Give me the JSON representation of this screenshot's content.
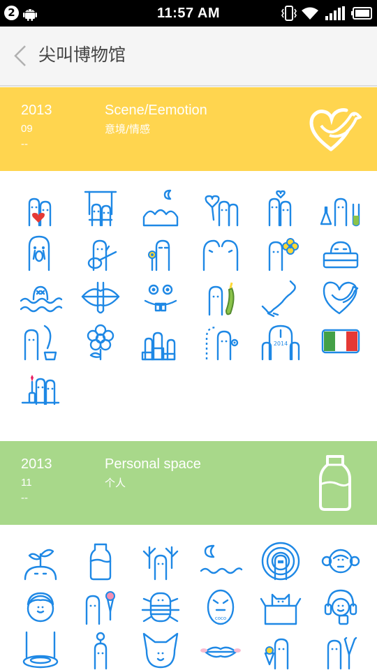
{
  "status_bar": {
    "notification_count": "2",
    "time": "11:57 AM",
    "icons": [
      "android-icon",
      "vibrate-icon",
      "wifi-icon",
      "signal-icon",
      "battery-icon"
    ]
  },
  "header": {
    "title": "尖叫博物馆",
    "back_icon": "chevron-left-icon"
  },
  "colors": {
    "yellow_banner": "#ffd54f",
    "green_banner": "#a8d88a",
    "sticker_blue": "#1e88e5"
  },
  "categories": [
    {
      "year": "2013",
      "month": "09",
      "dash": "--",
      "name_en": "Scene/Eemotion",
      "name_cn": "意境/情感",
      "icon": "heart-bird-icon",
      "stickers": [
        "couple-heart",
        "swing-couple",
        "hills-moon",
        "balloon-heart",
        "love-couple",
        "chemistry-flasks",
        "crying-ghost",
        "guitar-singer",
        "flower-holder",
        "whispering-pair",
        "flower-face",
        "sleeping-bed",
        "drowning-waves",
        "lips-finger",
        "buck-teeth-face",
        "cucumber-holder",
        "phone-call",
        "heart-bird",
        "quill-writer",
        "big-flower",
        "podium-123",
        "dotted-flower",
        "calendar-2014",
        "italy-flag",
        "flower-vase"
      ]
    },
    {
      "year": "2013",
      "month": "11",
      "dash": "--",
      "name_en": "Personal space",
      "name_cn": "个人",
      "icon": "milk-bottle-icon",
      "stickers": [
        "sprout-head",
        "milk-bottle",
        "branch-antlers",
        "moon-waves",
        "target-rings",
        "monkey-face",
        "boy-face",
        "ice-cream",
        "robot-bug",
        "coco-egg",
        "cat-box",
        "headphones-drink",
        "swing-seat",
        "lighthouse-person",
        "cat-face",
        "blushing-lips",
        "snack-holder",
        "peace-sign"
      ]
    }
  ]
}
